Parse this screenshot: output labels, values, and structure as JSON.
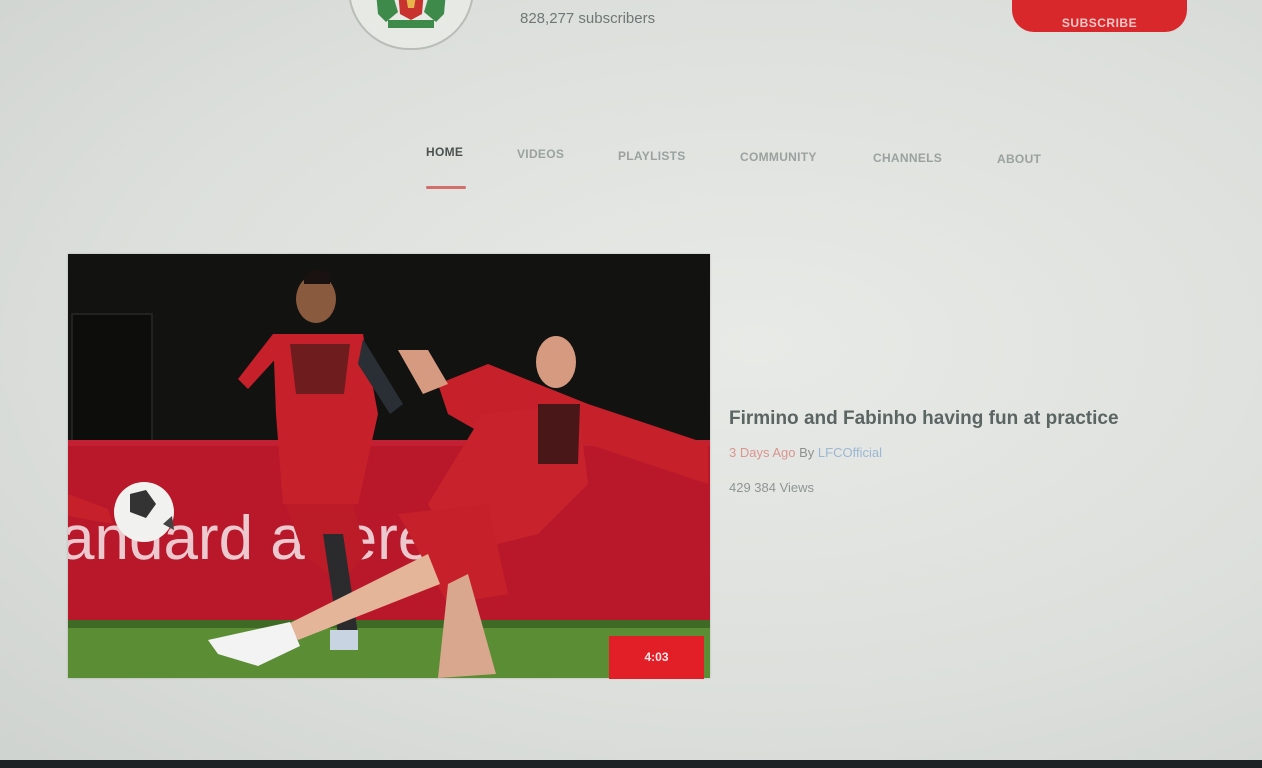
{
  "channel": {
    "logo_icon": "liverbird-crest-icon",
    "subscribers": "828,277 subscribers",
    "subscribe_label": "SUBSCRIBE"
  },
  "tabs": [
    {
      "label": "HOME",
      "active": true
    },
    {
      "label": "VIDEOS",
      "active": false
    },
    {
      "label": "PLAYLISTS",
      "active": false
    },
    {
      "label": "COMMUNITY",
      "active": false
    },
    {
      "label": "CHANNELS",
      "active": false
    },
    {
      "label": "ABOUT",
      "active": false
    }
  ],
  "featured": {
    "title": "Firmino and Fabinho having fun at practice",
    "age": "3 Days Ago",
    "by": "By",
    "channel": "LFCOfficial",
    "views": "429 384 Views",
    "duration": "4:03",
    "banner_text": "andard  artered"
  },
  "colors": {
    "accent": "#e21f27",
    "active_tab": "#4a5250",
    "underline": "#d36f6a"
  }
}
